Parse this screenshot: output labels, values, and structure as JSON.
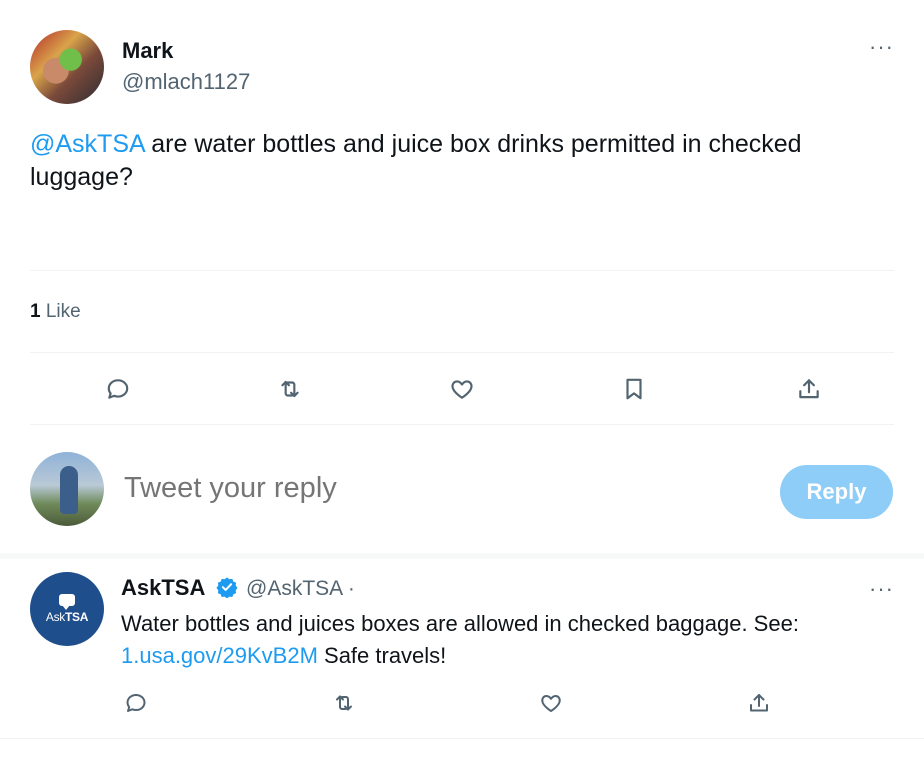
{
  "main_tweet": {
    "author_name": "Mark",
    "author_handle": "@mlach1127",
    "more_label": "···",
    "mention": "@AskTSA",
    "text": " are water bottles and juice box drinks permitted in checked luggage?",
    "like_count": "1",
    "like_label": " Like",
    "actions": [
      "reply-icon",
      "retweet-icon",
      "like-icon",
      "bookmark-icon",
      "share-icon"
    ]
  },
  "composer": {
    "placeholder": "Tweet your reply",
    "reply_button": "Reply"
  },
  "reply_tweet": {
    "avatar_label_prefix": "Ask",
    "avatar_label_bold": "TSA",
    "author_name": "AskTSA",
    "author_handle": "@AskTSA ·",
    "more_label": "···",
    "text_before_link": "Water bottles and juices boxes are allowed in checked baggage. See: ",
    "link": "1.usa.gov/29KvB2M",
    "text_after_link": " Safe travels!",
    "actions": [
      "reply-icon",
      "retweet-icon",
      "like-icon",
      "share-icon"
    ]
  },
  "colors": {
    "accent": "#1d9bf0",
    "reply_button_disabled": "#8ecdf8",
    "secondary_text": "#536471",
    "verified_badge": "#1d9bf0"
  }
}
